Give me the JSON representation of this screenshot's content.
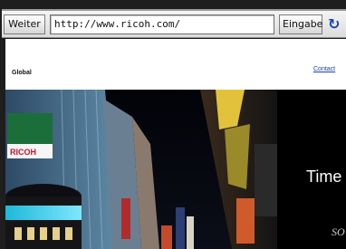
{
  "toolbar": {
    "back_label": "Weiter",
    "url_value": "http://www.ricoh.com/",
    "go_label": "Eingabe",
    "reload_icon": "reload-icon",
    "reload_glyph": "↻"
  },
  "page_header": {
    "global_label": "Global",
    "contact_label": "Contact"
  },
  "hero": {
    "title": "Time",
    "subtitle": "SO",
    "sign_text": "RICOH"
  },
  "colors": {
    "link": "#1a3fb0",
    "brand_red": "#c8102e"
  }
}
